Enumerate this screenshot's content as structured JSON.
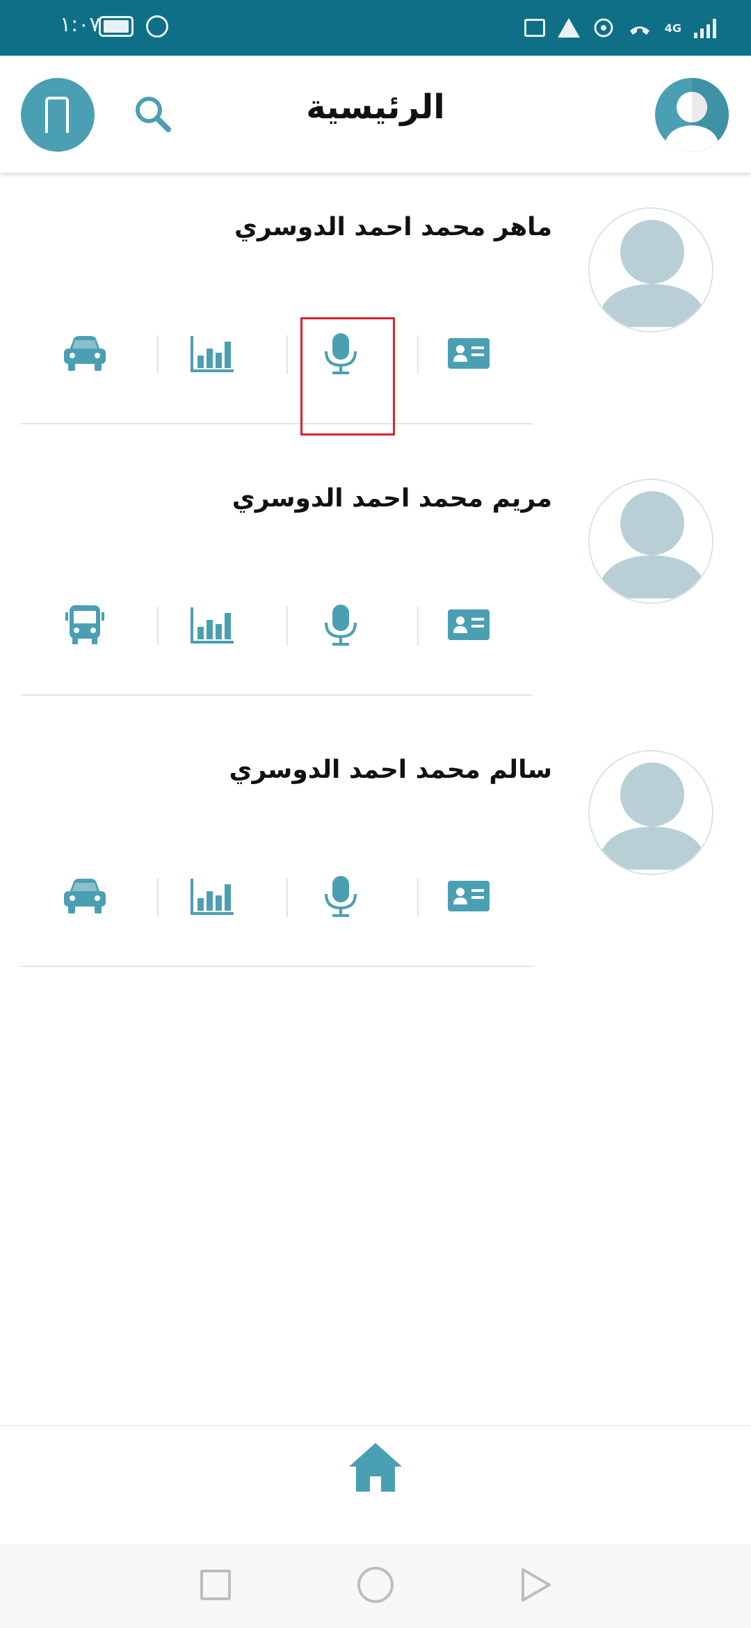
{
  "status_bar": {
    "time": "١:٠٧",
    "icons": [
      "battery-icon",
      "alarm-icon",
      "mail-icon",
      "warning-icon",
      "hotspot-icon",
      "call-icon",
      "network-4g-icon",
      "signal-icon"
    ],
    "network": "4G"
  },
  "header": {
    "title": "الرئيسية",
    "left_icons": [
      "gate-icon",
      "search-icon"
    ],
    "right_icon": "profile-avatar-icon"
  },
  "members": [
    {
      "name": "ماهر محمد احمد الدوسري",
      "transport_icon": "car-icon",
      "actions": [
        "car-icon",
        "bar-chart-icon",
        "microphone-icon",
        "id-card-icon"
      ]
    },
    {
      "name": "مريم محمد احمد الدوسري",
      "transport_icon": "bus-icon",
      "actions": [
        "bus-icon",
        "bar-chart-icon",
        "microphone-icon",
        "id-card-icon"
      ]
    },
    {
      "name": "سالم محمد احمد الدوسري",
      "transport_icon": "car-icon",
      "actions": [
        "car-icon",
        "bar-chart-icon",
        "microphone-icon",
        "id-card-icon"
      ]
    }
  ],
  "bottom_nav": {
    "items": [
      "home-icon"
    ]
  },
  "system_nav": {
    "buttons": [
      "recent-apps-icon",
      "home-circle-icon",
      "back-icon"
    ]
  },
  "colors": {
    "accent": "#4b9fb3",
    "status_bar": "#0e6f86",
    "highlight": "#d9232e",
    "avatar_placeholder": "#b9cfd6"
  }
}
